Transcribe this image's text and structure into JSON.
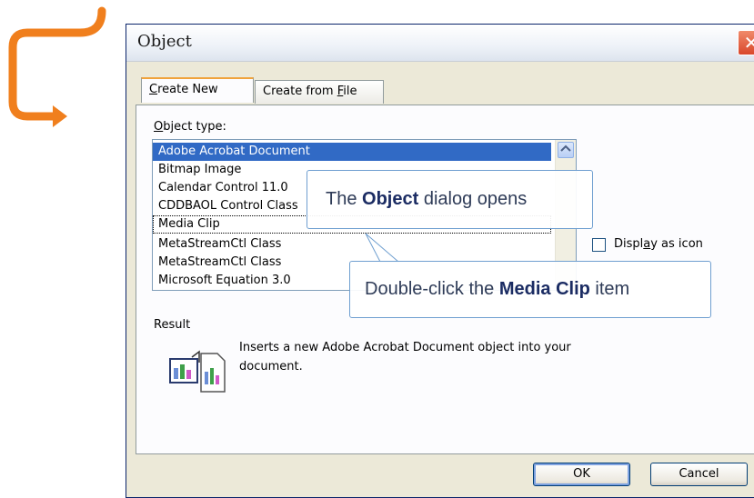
{
  "dialog": {
    "title": "Object",
    "close_glyph": "✕",
    "tabs": [
      {
        "label_prefix": "",
        "label_accel": "C",
        "label_suffix": "reate New"
      },
      {
        "label_prefix": "Create from ",
        "label_accel": "F",
        "label_suffix": "ile"
      }
    ],
    "object_type_label_accel": "O",
    "object_type_label_rest": "bject type:",
    "object_types": [
      "Adobe Acrobat Document",
      "Bitmap Image",
      "Calendar Control 11.0",
      "CDDBAOL Control Class",
      "Media Clip",
      "MetaStreamCtl Class",
      "MetaStreamCtl Class",
      "Microsoft Equation 3.0"
    ],
    "selected_index": 0,
    "display_as_icon": {
      "label_prefix": "Displ",
      "label_accel": "a",
      "label_suffix": "y as icon",
      "checked": false
    },
    "result_label": "Result",
    "result_text": "Inserts a new Adobe Acrobat Document object into your document.",
    "ok_label": "OK",
    "cancel_label": "Cancel"
  },
  "callouts": {
    "dialog_opens": {
      "before": "The ",
      "bold": "Object",
      "after": " dialog opens"
    },
    "double_click": {
      "before": "Double-click the ",
      "bold": "Media Clip",
      "after": " item"
    }
  },
  "colors": {
    "arrow": "#f07f1d",
    "selection": "#316ac5",
    "active_tab_accent": "#f0a33c",
    "callout_border": "#6f9fd0"
  },
  "icons": {
    "arrow": "curved-arrow-icon",
    "scroll_up": "scroll-up-arrow-icon",
    "result": "document-insert-icon"
  }
}
